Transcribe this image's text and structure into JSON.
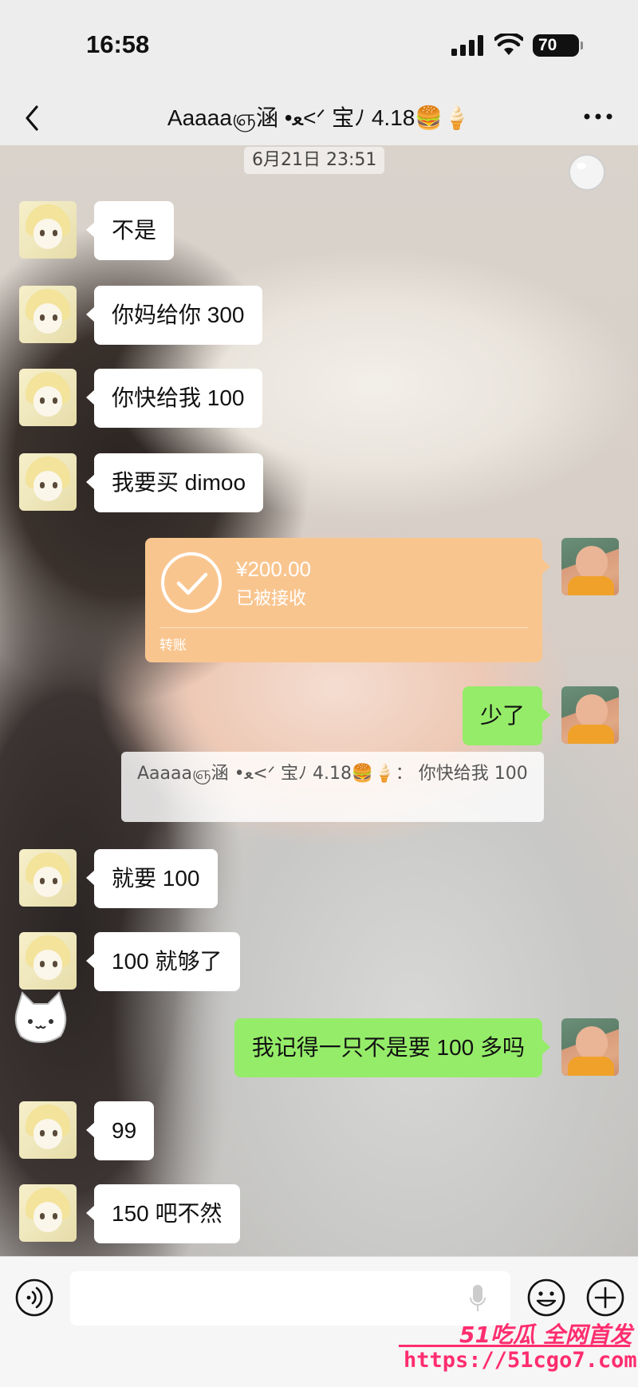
{
  "status_bar": {
    "time": "16:58",
    "battery": "70",
    "icons": [
      "signal-icon",
      "wifi-icon",
      "battery-icon"
    ]
  },
  "header": {
    "title": "Aaaaaஞ涵 •ﻌ<ᐟ 宝ﾉ 4.18🍔🍦",
    "back_icon": "chevron-left-icon",
    "more_icon": "more-icon"
  },
  "chat": {
    "timestamp": "6月21日 23:51",
    "messages": [
      {
        "side": "in",
        "text": "不是"
      },
      {
        "side": "in",
        "text": "你妈给你 300"
      },
      {
        "side": "in",
        "text": "你快给我 100"
      },
      {
        "side": "in",
        "text": "我要买 dimoo"
      },
      {
        "side": "out",
        "type": "transfer",
        "amount": "¥200.00",
        "status": "已被接收",
        "label": "转账"
      },
      {
        "side": "out",
        "text": "少了"
      },
      {
        "side": "quote",
        "text": "Aaaaaஞ涵 •ﻌ<ᐟ 宝ﾉ 4.18🍔🍦： 你快给我 100"
      },
      {
        "side": "in",
        "text": "就要 100"
      },
      {
        "side": "in",
        "text": "100 就够了"
      },
      {
        "side": "out",
        "text": "我记得一只不是要 100 多吗"
      },
      {
        "side": "in",
        "text": "99"
      },
      {
        "side": "in",
        "text": "150 吧不然"
      }
    ]
  },
  "input_bar": {
    "placeholder": "",
    "icons": [
      "voice-icon",
      "mic-icon",
      "emoji-icon",
      "plus-icon"
    ]
  },
  "watermark": {
    "brand": "51吃瓜 全网首发",
    "url": "https://51cgo7.com"
  },
  "colors": {
    "incoming_bubble": "#ffffff",
    "outgoing_bubble": "#95ec69",
    "transfer_card": "#f9c58f",
    "watermark": "#ff2d6f"
  }
}
